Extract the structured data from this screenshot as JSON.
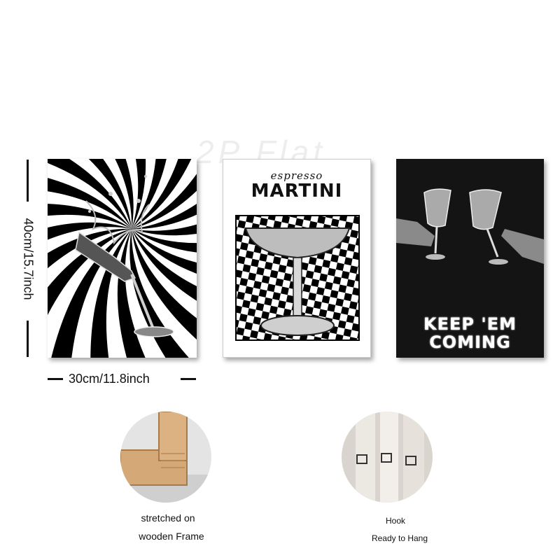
{
  "watermark": "2P Flat",
  "dimensions": {
    "height": "40cm/15.7inch",
    "width": "30cm/11.8inch"
  },
  "prints": [
    {
      "id": "swirl",
      "description_visible": "black and white radial swirl with martini glass splash"
    },
    {
      "id": "martini",
      "small_text": "espresso",
      "big_text": "MARTINI"
    },
    {
      "id": "keep",
      "line1": "KEEP 'EM",
      "line2": "COMING"
    }
  ],
  "features": {
    "frame_caption_line1": "stretched on",
    "frame_caption_line2": "wooden Frame",
    "hook_caption_line1": "Hook",
    "hook_caption_line2": "Ready to Hang"
  }
}
